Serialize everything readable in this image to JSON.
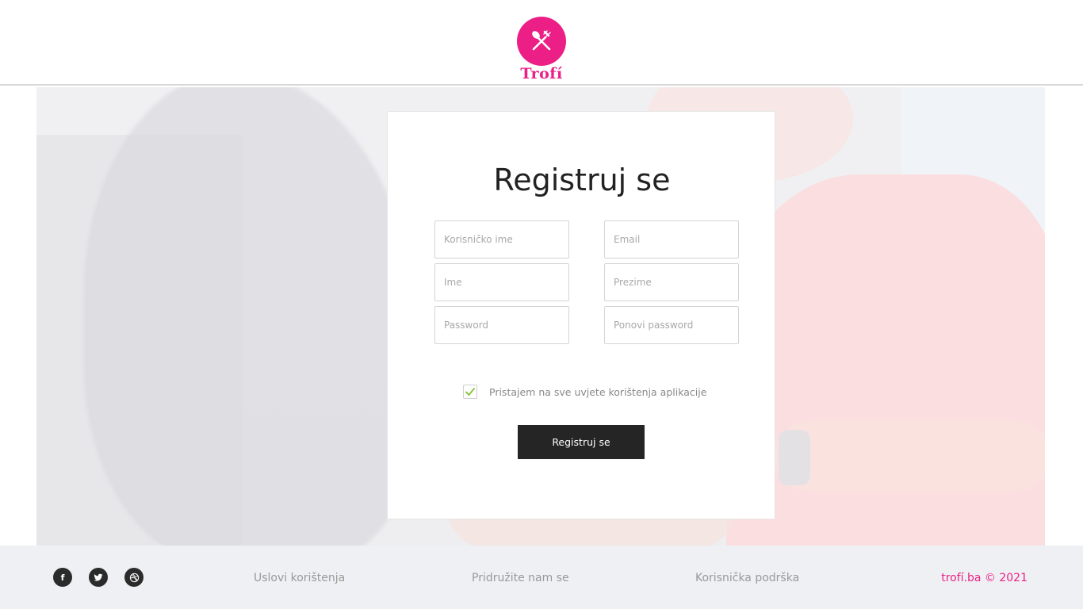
{
  "brand": {
    "name": "Trofí",
    "accent_color": "#ec1f86",
    "logo_icon": "fork-and-knife-icon"
  },
  "form": {
    "title": "Registruj se",
    "fields": {
      "username_placeholder": "Korisničko ime",
      "email_placeholder": "Email",
      "first_name_placeholder": "Ime",
      "last_name_placeholder": "Prezime",
      "password_placeholder": "Password",
      "repeat_password_placeholder": "Ponovi password"
    },
    "terms": {
      "checked": true,
      "label": "Pristajem na sve uvjete korištenja aplikacije"
    },
    "submit_label": "Registruj se"
  },
  "footer": {
    "social": [
      {
        "name": "facebook-icon",
        "glyph": "f"
      },
      {
        "name": "twitter-icon",
        "glyph": "🐦"
      },
      {
        "name": "dribbble-icon",
        "glyph": "◎"
      }
    ],
    "links": {
      "terms": "Uslovi korištenja",
      "join": "Pridružite nam se",
      "support": "Korisnička podrška"
    },
    "copyright": "trofí.ba © 2021"
  }
}
